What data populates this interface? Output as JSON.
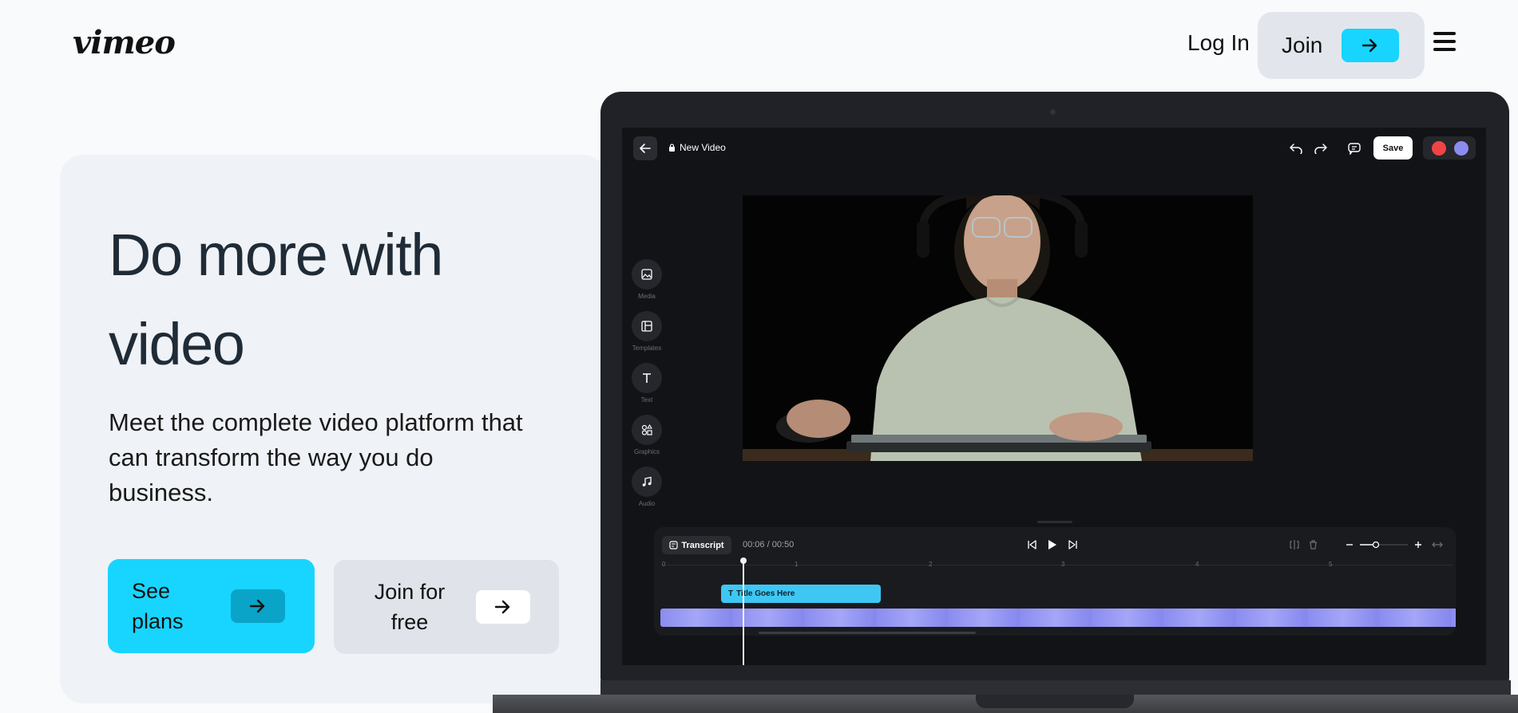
{
  "header": {
    "logo": "vimeo",
    "login_label": "Log In",
    "join_label": "Join"
  },
  "hero": {
    "title": "Do more with video",
    "description": "Meet the complete video platform that can transform the way you do business.",
    "primary_button": "See plans",
    "secondary_button": "Join for free"
  },
  "editor": {
    "project_title": "New Video",
    "save_label": "Save",
    "tools": [
      "Media",
      "Templates",
      "Text",
      "Graphics",
      "Audio"
    ],
    "transcript_label": "Transcript",
    "time_readout": "00:06 / 00:50",
    "ruler_ticks": [
      "0",
      "1",
      "2",
      "3",
      "4",
      "5"
    ],
    "title_clip_label": "Title Goes Here",
    "avatar_colors": [
      "#ef4444",
      "#8b8cf0"
    ],
    "accent_color": "#17d5ff"
  }
}
